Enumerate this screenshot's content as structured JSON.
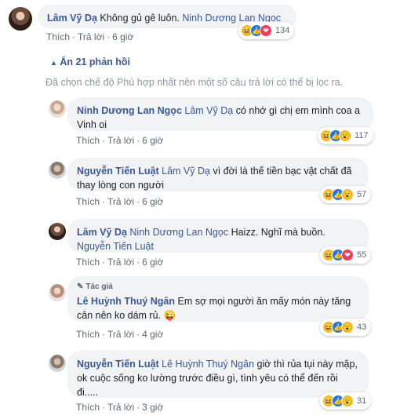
{
  "top_comment": {
    "name": "Lâm Vỹ Dạ",
    "text": "Không gủ gê luôn.",
    "mention": "Ninh Dương Lan Ngọc",
    "reactions_count": "134",
    "actions": {
      "like": "Thích",
      "reply": "Trả lời",
      "time": "6 giờ"
    }
  },
  "replies_toggle": "Ẩn 21 phản hồi",
  "filter_notice": "Đã chọn chế độ Phù hợp nhất nên một số câu trả lời có thể bị lọc ra.",
  "replies": [
    {
      "name": "Ninh Dương Lan Ngọc",
      "mention": "Lâm Vỹ Dạ",
      "text": "có nhớ gì chị em mình coa a Vinh oi",
      "reactions_count": "117",
      "actions": {
        "like": "Thích",
        "reply": "Trả lời",
        "time": "6 giờ"
      }
    },
    {
      "name": "Nguyễn Tiến Luật",
      "mention": "Lâm Vỹ Dạ",
      "text": "vì đời là thế tiền bạc vật chất đã thay lòng con người",
      "reactions_count": "57",
      "actions": {
        "like": "Thích",
        "reply": "Trả lời",
        "time": "6 giờ"
      }
    },
    {
      "name": "Lâm Vỹ Dạ",
      "mention": "Ninh Dương Lan Ngọc",
      "text": "Haizz. Nghĩ mà buồn.",
      "mention2": "Nguyễn Tiến Luật",
      "reactions_count": "55",
      "actions": {
        "like": "Thích",
        "reply": "Trả lời",
        "time": "6 giờ"
      }
    },
    {
      "author_tag": "Tác giả",
      "name": "Lê Huỳnh Thuý Ngân",
      "text": "Em sợ mọi người ăn mấy món này tăng cân nên ko dám rủ.",
      "emoji": "😜",
      "reactions_count": "43",
      "actions": {
        "like": "Thích",
        "reply": "Trả lời",
        "time": "4 giờ"
      }
    },
    {
      "name": "Nguyễn Tiến Luật",
      "mention": "Lê Huỳnh Thuý Ngân",
      "text": "giờ thì rủa tụi này mập, ok cuộc sống ko lường trước điều gì, tình yêu có thể đến rồi đi.....",
      "reactions_count": "31",
      "actions": {
        "like": "Thích",
        "reply": "Trả lời",
        "time": "3 giờ"
      }
    }
  ],
  "icons": {
    "haha": "😆",
    "like": "👍",
    "love": "❤",
    "wow": "😮",
    "chevron": "▲",
    "pencil": "✎"
  }
}
